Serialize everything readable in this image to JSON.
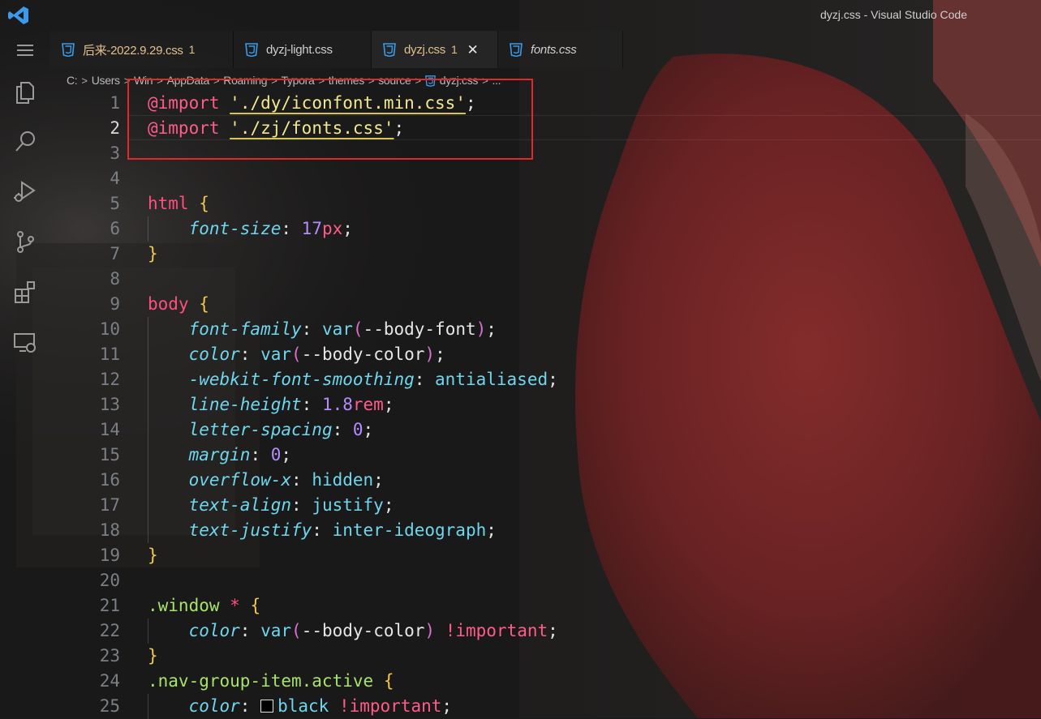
{
  "window": {
    "title": "dyzj.css - Visual Studio Code"
  },
  "colors": {
    "accent_blue": "#3a9bea",
    "warning_yellow": "#e2c08d",
    "annotation_red": "#e02a2a"
  },
  "activity_bar": {
    "items": [
      {
        "name": "menu",
        "icon": "hamburger-menu-icon"
      },
      {
        "name": "explorer",
        "icon": "files-icon"
      },
      {
        "name": "search",
        "icon": "search-icon"
      },
      {
        "name": "run-debug",
        "icon": "run-debug-icon"
      },
      {
        "name": "source-control",
        "icon": "source-control-icon"
      },
      {
        "name": "extensions",
        "icon": "extensions-icon"
      },
      {
        "name": "remote-explorer",
        "icon": "remote-explorer-icon"
      }
    ]
  },
  "tabs": [
    {
      "label": "后来-2022.9.29.css",
      "badge": "1",
      "color": "#e2c08d",
      "italic": false,
      "active": false,
      "icon": "css-file-icon"
    },
    {
      "label": "dyzj-light.css",
      "badge": "",
      "color": "#cfcfcf",
      "italic": false,
      "active": false,
      "icon": "css-file-icon"
    },
    {
      "label": "dyzj.css",
      "badge": "1",
      "color": "#e2c08d",
      "italic": false,
      "active": true,
      "close": "✕",
      "icon": "css-file-icon"
    },
    {
      "label": "fonts.css",
      "badge": "",
      "color": "#cfcfcf",
      "italic": true,
      "active": false,
      "icon": "css-file-icon"
    }
  ],
  "breadcrumb": [
    "C:",
    "Users",
    "Win",
    "AppData",
    "Roaming",
    "Typora",
    "themes",
    "source",
    "dyzj.css",
    "..."
  ],
  "editor": {
    "current_line": 2,
    "lines": [
      {
        "n": "1",
        "tokens": [
          [
            "@import",
            "at"
          ],
          [
            " ",
            "pun"
          ],
          [
            "'./dy/iconfont.min.css'",
            "str"
          ],
          [
            ";",
            "pun"
          ]
        ]
      },
      {
        "n": "2",
        "tokens": [
          [
            "@import",
            "at"
          ],
          [
            " ",
            "pun"
          ],
          [
            "'./zj/fonts.css'",
            "str"
          ],
          [
            ";",
            "pun"
          ]
        ]
      },
      {
        "n": "3",
        "tokens": []
      },
      {
        "n": "4",
        "tokens": []
      },
      {
        "n": "5",
        "tokens": [
          [
            "html",
            "sel"
          ],
          [
            " ",
            "pun"
          ],
          [
            "{",
            "br"
          ]
        ]
      },
      {
        "n": "6",
        "tokens": [
          [
            "    ",
            "pun"
          ],
          [
            "font-size",
            "prop"
          ],
          [
            ": ",
            "pun"
          ],
          [
            "17",
            "num"
          ],
          [
            "px",
            "unit"
          ],
          [
            ";",
            "pun"
          ]
        ]
      },
      {
        "n": "7",
        "tokens": [
          [
            "}",
            "br"
          ]
        ]
      },
      {
        "n": "8",
        "tokens": []
      },
      {
        "n": "9",
        "tokens": [
          [
            "body",
            "sel"
          ],
          [
            " ",
            "pun"
          ],
          [
            "{",
            "br"
          ]
        ]
      },
      {
        "n": "10",
        "tokens": [
          [
            "    ",
            "pun"
          ],
          [
            "font-family",
            "prop"
          ],
          [
            ": ",
            "pun"
          ],
          [
            "var",
            "fn"
          ],
          [
            "(",
            "par"
          ],
          [
            "--body-font",
            "var"
          ],
          [
            ")",
            "par"
          ],
          [
            ";",
            "pun"
          ]
        ]
      },
      {
        "n": "11",
        "tokens": [
          [
            "    ",
            "pun"
          ],
          [
            "color",
            "prop"
          ],
          [
            ": ",
            "pun"
          ],
          [
            "var",
            "fn"
          ],
          [
            "(",
            "par"
          ],
          [
            "--body-color",
            "var"
          ],
          [
            ")",
            "par"
          ],
          [
            ";",
            "pun"
          ]
        ]
      },
      {
        "n": "12",
        "tokens": [
          [
            "    ",
            "pun"
          ],
          [
            "-webkit-font-smoothing",
            "prop"
          ],
          [
            ": ",
            "pun"
          ],
          [
            "antialiased",
            "val"
          ],
          [
            ";",
            "pun"
          ]
        ]
      },
      {
        "n": "13",
        "tokens": [
          [
            "    ",
            "pun"
          ],
          [
            "line-height",
            "prop"
          ],
          [
            ": ",
            "pun"
          ],
          [
            "1.8",
            "num"
          ],
          [
            "rem",
            "unit"
          ],
          [
            ";",
            "pun"
          ]
        ]
      },
      {
        "n": "14",
        "tokens": [
          [
            "    ",
            "pun"
          ],
          [
            "letter-spacing",
            "prop"
          ],
          [
            ": ",
            "pun"
          ],
          [
            "0",
            "num"
          ],
          [
            ";",
            "pun"
          ]
        ]
      },
      {
        "n": "15",
        "tokens": [
          [
            "    ",
            "pun"
          ],
          [
            "margin",
            "prop"
          ],
          [
            ": ",
            "pun"
          ],
          [
            "0",
            "num"
          ],
          [
            ";",
            "pun"
          ]
        ]
      },
      {
        "n": "16",
        "tokens": [
          [
            "    ",
            "pun"
          ],
          [
            "overflow-x",
            "prop"
          ],
          [
            ": ",
            "pun"
          ],
          [
            "hidden",
            "val"
          ],
          [
            ";",
            "pun"
          ]
        ]
      },
      {
        "n": "17",
        "tokens": [
          [
            "    ",
            "pun"
          ],
          [
            "text-align",
            "prop"
          ],
          [
            ": ",
            "pun"
          ],
          [
            "justify",
            "val"
          ],
          [
            ";",
            "pun"
          ]
        ]
      },
      {
        "n": "18",
        "tokens": [
          [
            "    ",
            "pun"
          ],
          [
            "text-justify",
            "prop"
          ],
          [
            ": ",
            "pun"
          ],
          [
            "inter-ideograph",
            "val"
          ],
          [
            ";",
            "pun"
          ]
        ]
      },
      {
        "n": "19",
        "tokens": [
          [
            "}",
            "br"
          ]
        ]
      },
      {
        "n": "20",
        "tokens": []
      },
      {
        "n": "21",
        "tokens": [
          [
            ".window",
            "cls"
          ],
          [
            " ",
            "pun"
          ],
          [
            "*",
            "star"
          ],
          [
            " ",
            "pun"
          ],
          [
            "{",
            "br"
          ]
        ]
      },
      {
        "n": "22",
        "tokens": [
          [
            "    ",
            "pun"
          ],
          [
            "color",
            "prop"
          ],
          [
            ": ",
            "pun"
          ],
          [
            "var",
            "fn"
          ],
          [
            "(",
            "par"
          ],
          [
            "--body-color",
            "var"
          ],
          [
            ")",
            "par"
          ],
          [
            " ",
            "pun"
          ],
          [
            "!important",
            "imp"
          ],
          [
            ";",
            "pun"
          ]
        ]
      },
      {
        "n": "23",
        "tokens": [
          [
            "}",
            "br"
          ]
        ]
      },
      {
        "n": "24",
        "tokens": [
          [
            ".nav-group-item.active",
            "cls"
          ],
          [
            " ",
            "pun"
          ],
          [
            "{",
            "br"
          ]
        ]
      },
      {
        "n": "25",
        "tokens": [
          [
            "    ",
            "pun"
          ],
          [
            "color",
            "prop"
          ],
          [
            ": ",
            "pun"
          ],
          [
            "",
            "swatch"
          ],
          [
            "black",
            "val"
          ],
          [
            " ",
            "pun"
          ],
          [
            "!important",
            "imp"
          ],
          [
            ";",
            "pun"
          ]
        ]
      }
    ]
  }
}
